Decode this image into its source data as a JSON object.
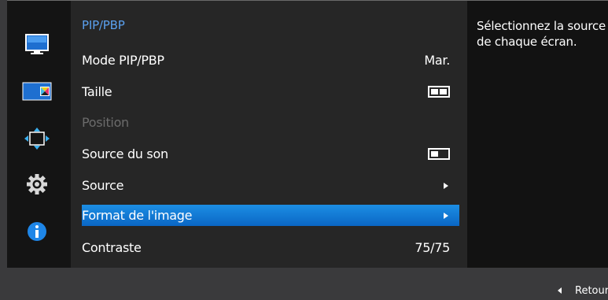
{
  "sidebar": {
    "icons": [
      "monitor-picture-icon",
      "color-icon",
      "resize-arrows-icon",
      "gear-icon",
      "info-icon"
    ]
  },
  "menu": {
    "title": "PIP/PBP",
    "items": [
      {
        "label": "Mode PIP/PBP",
        "value": "Mar.",
        "state": "normal"
      },
      {
        "label": "Taille",
        "value_icon": "pbp-split-icon",
        "state": "normal"
      },
      {
        "label": "Position",
        "state": "disabled"
      },
      {
        "label": "Source du son",
        "value_icon": "pip-main-icon",
        "state": "normal"
      },
      {
        "label": "Source",
        "value_icon": "arrow-right-icon",
        "state": "normal"
      },
      {
        "label": "Format de l'image",
        "value_icon": "arrow-right-icon",
        "state": "selected"
      },
      {
        "label": "Contraste",
        "value": "75/75",
        "state": "normal"
      }
    ]
  },
  "help": {
    "text": "Sélectionnez la source de chaque écran."
  },
  "footer": {
    "back_label": "Retour"
  },
  "colors": {
    "accent": "#1a7fdc",
    "title_blue": "#5aa0ee",
    "disabled": "#6b6b6b"
  }
}
